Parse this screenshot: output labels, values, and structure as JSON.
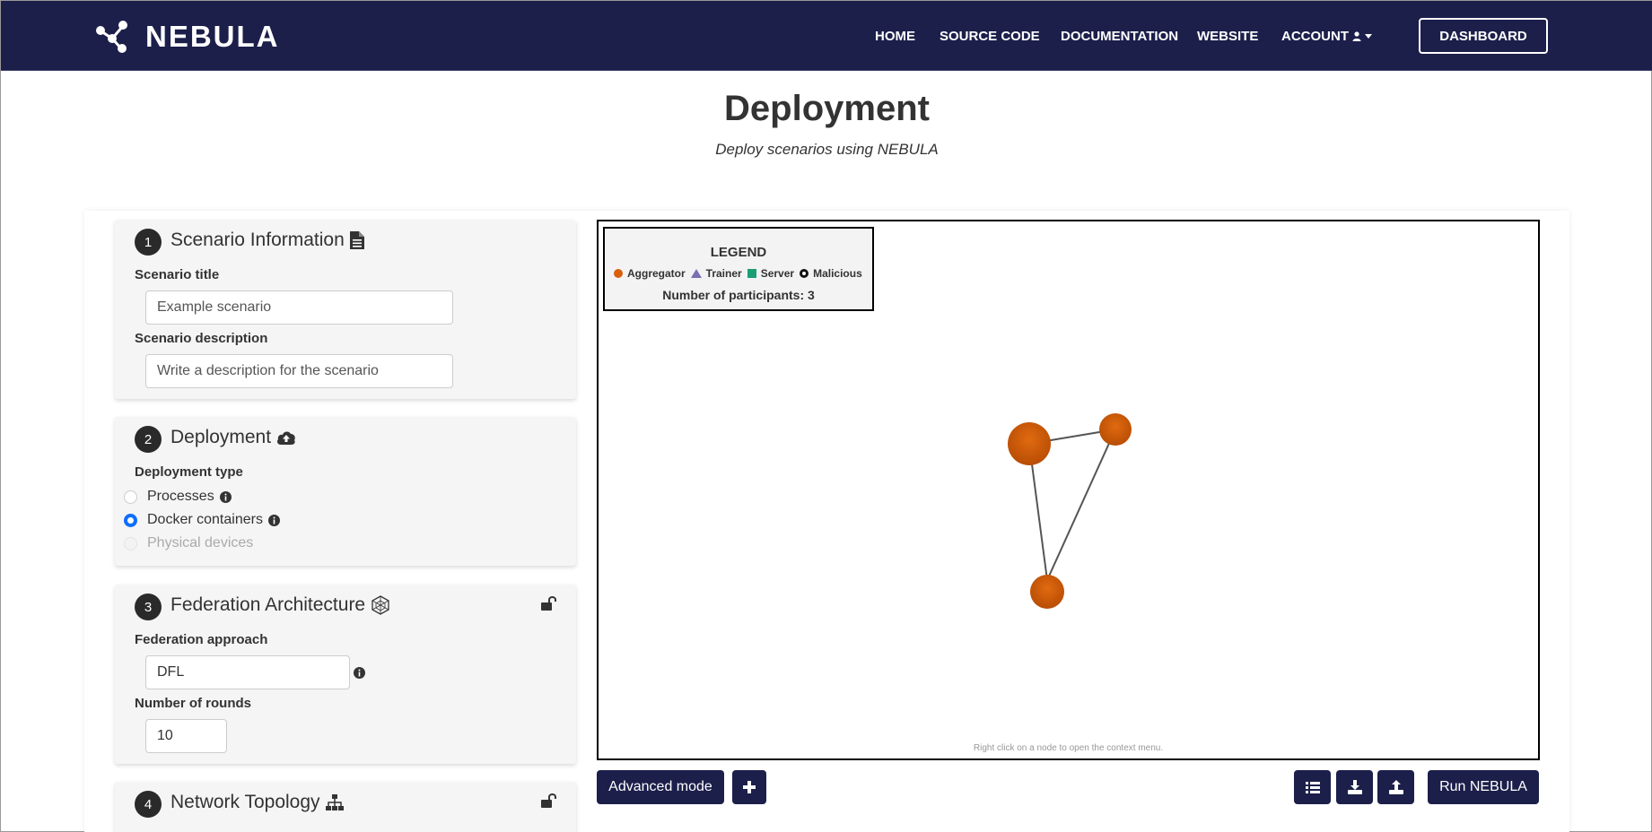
{
  "navbar": {
    "brand": "NEBULA",
    "links": [
      "HOME",
      "SOURCE CODE",
      "DOCUMENTATION",
      "WEBSITE",
      "ACCOUNT"
    ],
    "dashboard_label": "DASHBOARD"
  },
  "header": {
    "title": "Deployment",
    "subtitle": "Deploy scenarios using NEBULA"
  },
  "cards": {
    "scenario": {
      "number": "1",
      "title": "Scenario Information",
      "title_label": "Scenario title",
      "title_placeholder": "Example scenario",
      "description_label": "Scenario description",
      "description_placeholder": "Write a description for the scenario"
    },
    "deployment": {
      "number": "2",
      "title": "Deployment",
      "type_label": "Deployment type",
      "options": [
        "Processes",
        "Docker containers",
        "Physical devices"
      ],
      "selected": "Docker containers"
    },
    "federation": {
      "number": "3",
      "title": "Federation Architecture",
      "approach_label": "Federation approach",
      "approach_value": "DFL",
      "rounds_label": "Number of rounds",
      "rounds_value": "10"
    },
    "topology": {
      "number": "4",
      "title": "Network Topology"
    }
  },
  "graph": {
    "legend_title": "LEGEND",
    "legend_items": [
      "Aggregator",
      "Trainer",
      "Server",
      "Malicious"
    ],
    "participants_label": "Number of participants: 3",
    "hint": "Right click on a node to open the context menu.",
    "colors": {
      "aggregator": "#d95f0e",
      "trainer": "#7a6fb0",
      "server": "#1a9e77",
      "malicious": "#111111"
    }
  },
  "buttons": {
    "advanced_mode": "Advanced mode",
    "run": "Run NEBULA"
  }
}
